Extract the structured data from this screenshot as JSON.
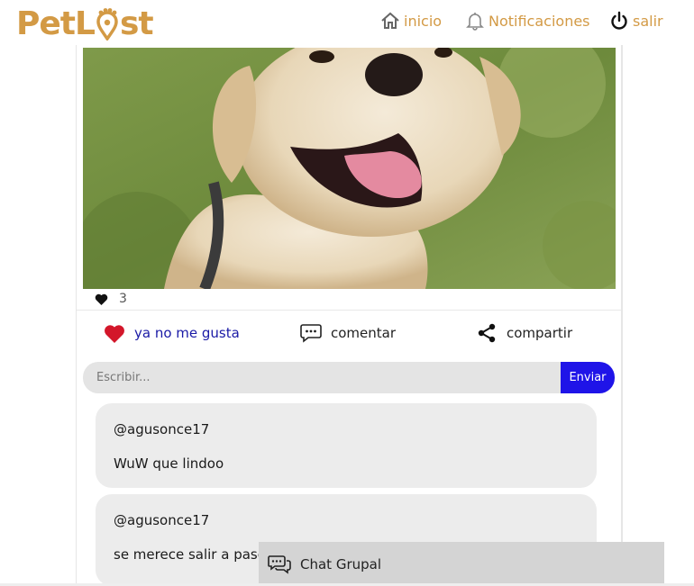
{
  "header": {
    "logo_text_start": "PetL",
    "logo_text_end": "st",
    "nav": [
      {
        "label": "inicio",
        "icon": "home-icon"
      },
      {
        "label": "Notificaciones",
        "icon": "bell-icon"
      },
      {
        "label": "salir",
        "icon": "power-icon"
      }
    ],
    "brand_color": "#d39a45"
  },
  "post": {
    "image_subject": "dog-photo",
    "likes_count": "3",
    "actions": {
      "like_label": "ya no me gusta",
      "comment_label": "comentar",
      "share_label": "compartir"
    },
    "comment_form": {
      "placeholder": "Escribir...",
      "send_label": "Enviar"
    },
    "comments": [
      {
        "user": "@agusonce17",
        "text": "WuW que lindoo"
      },
      {
        "user": "@agusonce17",
        "text": "se merece salir a pasear"
      }
    ]
  },
  "chat": {
    "label": "Chat Grupal"
  },
  "colors": {
    "accent": "#1f14e8",
    "like_heart": "#d3162a",
    "like_text": "#1a1aa6"
  }
}
